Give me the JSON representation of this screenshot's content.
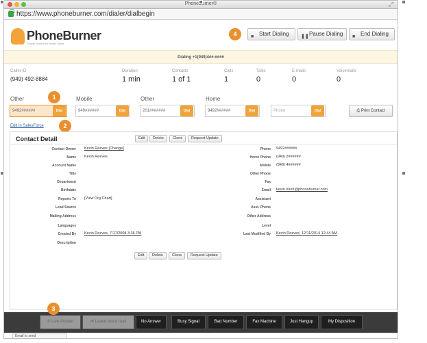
{
  "window": {
    "title": "PhoneBurner®",
    "url": "https://www.phoneburner.com/dialer/dialbegin"
  },
  "logo": {
    "name": "PhoneBurner",
    "tagline": "Power Dialers for Inside Sales"
  },
  "header": {
    "badge": "4",
    "buttons": [
      {
        "label": "Start Dialing",
        "icon": "stop-icon"
      },
      {
        "label": "Pause Dialing",
        "icon": "pause-icon"
      },
      {
        "label": "End Dialing",
        "icon": "stop-icon"
      }
    ]
  },
  "dialing_text": "Dialing +1(949)4##-####",
  "stats": {
    "caller_id": {
      "label": "Caller ID",
      "value": "(949) 492-8884"
    },
    "duration": {
      "label": "Duration",
      "value": "1 min"
    },
    "contacts": {
      "label": "Contacts",
      "value": "1 of 1"
    },
    "calls": {
      "label": "Calls",
      "value": "1"
    },
    "talks": {
      "label": "Talks",
      "value": "0"
    },
    "emails": {
      "label": "E-mails",
      "value": "0"
    },
    "voicemails": {
      "label": "Voicemails",
      "value": "0"
    }
  },
  "phones": [
    {
      "label": "Other",
      "value": "9492######",
      "dial": "Dial",
      "badge": "1"
    },
    {
      "label": "Mobile",
      "value": "949######",
      "dial": "Dial"
    },
    {
      "label": "Other",
      "value": "201#######",
      "dial": "Dial"
    },
    {
      "label": "Home",
      "value": "9492######",
      "dial": "Dial"
    },
    {
      "label": "",
      "value": "Phone",
      "dial": "Dial"
    }
  ],
  "print_contact": "Print Contact",
  "edit_salesforce": "Edit in SalesForce",
  "badge2": "2",
  "contact_detail": {
    "title": "Contact Detail",
    "actions": [
      "Edit",
      "Delete",
      "Clone",
      "Request Update"
    ],
    "left": [
      {
        "label": "Contact Owner",
        "value": "Kevin Reeves [Change]"
      },
      {
        "label": "Name",
        "value": "Kevin Reeves"
      },
      {
        "label": "Account Name",
        "value": ""
      },
      {
        "label": "Title",
        "value": ""
      },
      {
        "label": "Department",
        "value": ""
      },
      {
        "label": "Birthdate",
        "value": ""
      },
      {
        "label": "Reports To",
        "value": "[View Org Chart]"
      },
      {
        "label": "Lead Source",
        "value": ""
      },
      {
        "label": "Mailing Address",
        "value": ""
      },
      {
        "label": "Languages",
        "value": ""
      },
      {
        "label": "Created By",
        "value": "Kevin Reeves, 7/17/2008 3:36 PM"
      },
      {
        "label": "Description",
        "value": ""
      }
    ],
    "right": [
      {
        "label": "Phone",
        "value": "9492######"
      },
      {
        "label": "Home Phone",
        "value": "(949) 2######"
      },
      {
        "label": "Mobile",
        "value": "(949) 4######"
      },
      {
        "label": "Other Phone",
        "value": ""
      },
      {
        "label": "Fax",
        "value": ""
      },
      {
        "label": "Email",
        "value": "kevin.####@phoneburner.com"
      },
      {
        "label": "Assistant",
        "value": ""
      },
      {
        "label": "Asst. Phone",
        "value": ""
      },
      {
        "label": "Other Address",
        "value": ""
      },
      {
        "label": "Level",
        "value": ""
      },
      {
        "label": "Last Modified By",
        "value": "Kevin Reeves, 12/11/2014 12:44 AM"
      }
    ]
  },
  "bottom": {
    "badge3": "3",
    "buttons": [
      "Live Answer",
      "Leave Voice mail",
      "No Answer",
      "Busy Signal",
      "Bad Number",
      "Fax Machine",
      "Just Hangup",
      "My Disposition"
    ]
  },
  "footer": {
    "email_select": "Email to send"
  }
}
